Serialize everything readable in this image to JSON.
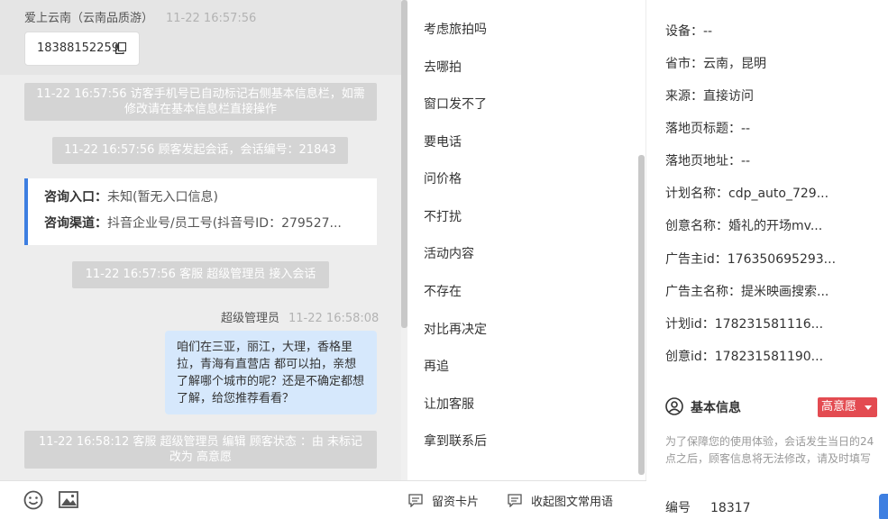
{
  "chat": {
    "visitor_name": "爱上云南（云南品质游）",
    "visitor_time": "11-22 16:57:56",
    "phone": "18388152259",
    "system_messages": [
      "11-22 16:57:56 访客手机号已自动标记右侧基本信息栏，如需修改请在基本信息栏直接操作",
      "11-22 16:57:56 顾客发起会话，会话编号：21843",
      "11-22 16:57:56 客服 超级管理员 接入会话",
      "11-22 16:58:12 客服 超级管理员 编辑 顾客状态 ：由 未标记 改为 高意愿"
    ],
    "entry": {
      "label": "咨询入口：",
      "value": "未知(暂无入口信息)"
    },
    "channel": {
      "label": "咨询渠道：",
      "value": "抖音企业号/员工号(抖音号ID：279527..."
    },
    "agent_name": "超级管理员",
    "agent_time": "11-22 16:58:08",
    "agent_message": "咱们在三亚，丽江，大理，香格里拉，青海有直营店 都可以拍，亲想了解哪个城市的呢？还是不确定都想了解，给您推荐看看？"
  },
  "quick_replies": [
    "考虑旅拍吗",
    "去哪拍",
    "窗口发不了",
    "要电话",
    "问价格",
    "不打扰",
    "活动内容",
    "不存在",
    "对比再决定",
    "再追",
    "让加客服",
    "拿到联系后"
  ],
  "toolbar": {
    "card_label": "留资卡片",
    "collapse_label": "收起图文常用语"
  },
  "panel": {
    "rows": [
      "设备：--",
      "省市：云南，昆明",
      "来源：直接访问",
      "落地页标题：--",
      "落地页地址：--",
      "计划名称：cdp_auto_729...",
      "创意名称：婚礼的开场mv...",
      "广告主id：176350695293...",
      "广告主名称：提米映画搜索...",
      "计划id：178231581116...",
      "创意id：178231581190..."
    ],
    "basic_info_title": "基本信息",
    "intent_badge": "高意愿",
    "notice": "为了保障您的使用体验，会话发生当日的24点之后，顾客信息将无法修改，请及时填写",
    "id_label": "编号",
    "id_value": "18317"
  },
  "colors": {
    "accent": "#3e7fe1",
    "agent_bubble": "#d6e8fc",
    "system_message": "#d4d4d4",
    "badge": "#e34b51"
  }
}
